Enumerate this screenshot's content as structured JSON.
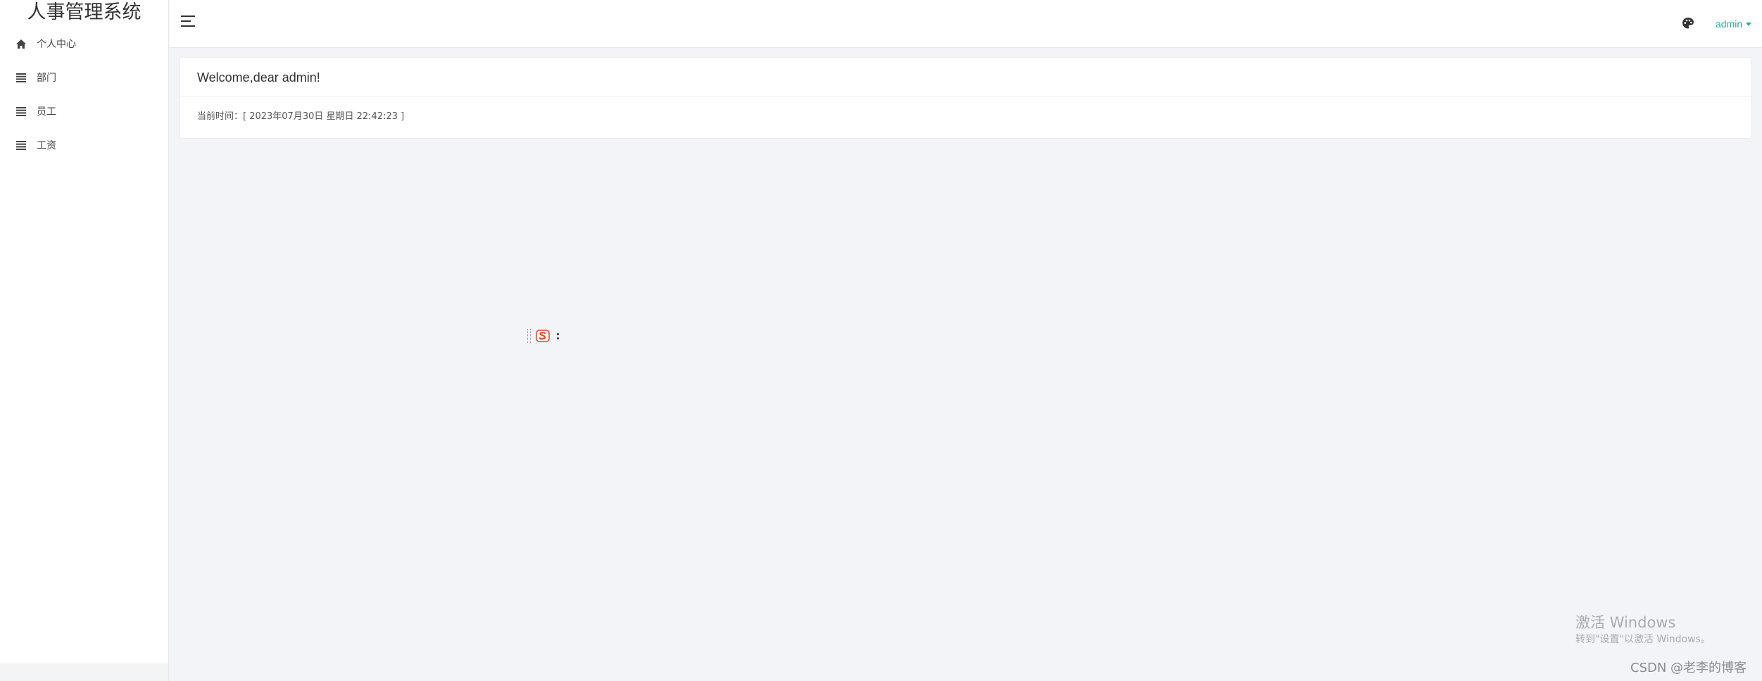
{
  "app": {
    "title": "人事管理系统"
  },
  "sidebar": {
    "items": [
      {
        "label": "个人中心",
        "icon": "home-icon"
      },
      {
        "label": "部门",
        "icon": "list-icon"
      },
      {
        "label": "员工",
        "icon": "list-icon"
      },
      {
        "label": "工资",
        "icon": "list-icon"
      }
    ]
  },
  "header": {
    "toggle_icon": "menu-toggle-icon",
    "theme_icon": "palette-icon",
    "user": "admin"
  },
  "welcome": {
    "title": "Welcome,dear admin!",
    "time_text": "当前时间：[ 2023年07月30日 星期日 22:42:23 ]"
  },
  "overlay": {
    "watermark_title": "激活 Windows",
    "watermark_sub": "转到\"设置\"以激活 Windows。",
    "csdn": "CSDN @老李的博客",
    "ime_icon": "sogou-ime-icon"
  },
  "colors": {
    "accent": "#1ab1a0",
    "background": "#f3f4f8",
    "sidebar_bg": "#ffffff"
  }
}
